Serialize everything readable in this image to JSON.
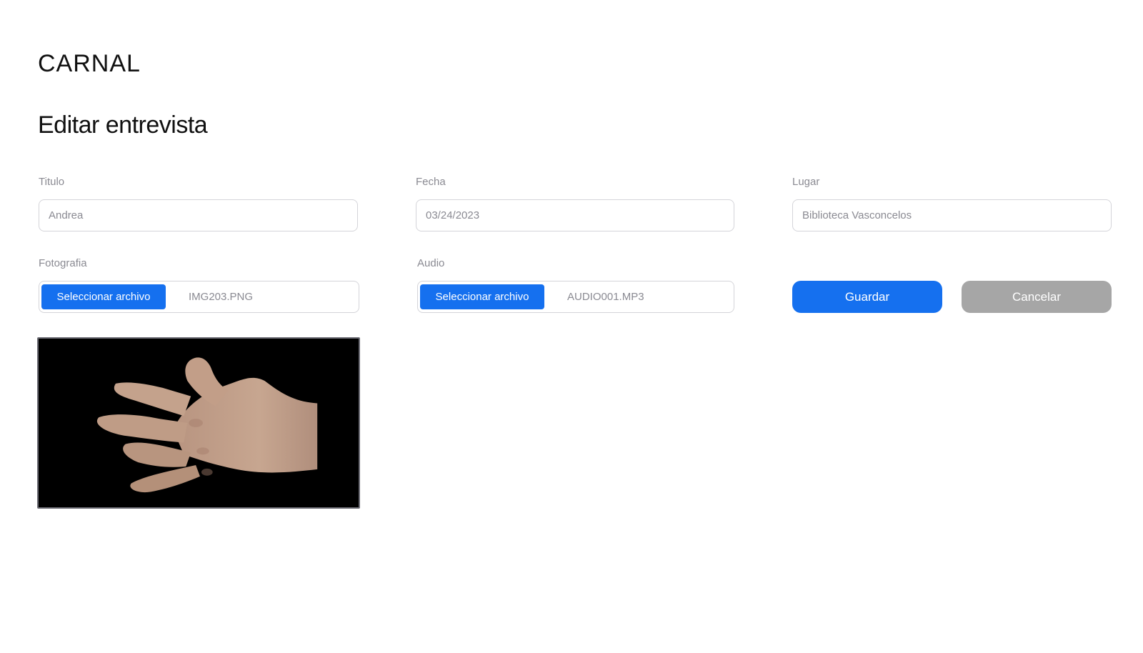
{
  "app": {
    "logo": "CARNAL"
  },
  "page": {
    "title": "Editar entrevista"
  },
  "form": {
    "titulo": {
      "label": "Titulo",
      "value": "Andrea"
    },
    "fecha": {
      "label": "Fecha",
      "value": "03/24/2023"
    },
    "lugar": {
      "label": "Lugar",
      "value": "Biblioteca Vasconcelos"
    },
    "fotografia": {
      "label": "Fotografia",
      "button": "Seleccionar archivo",
      "file": "IMG203.PNG"
    },
    "audio": {
      "label": "Audio",
      "button": "Seleccionar archivo",
      "file": "AUDIO001.MP3"
    }
  },
  "actions": {
    "save": "Guardar",
    "cancel": "Cancelar"
  },
  "colors": {
    "primary": "#1570ef",
    "secondary": "#a6a6a6",
    "muted_text": "#8a8a92",
    "border": "#d4d4d9"
  },
  "preview": {
    "icon": "hand-photo"
  }
}
